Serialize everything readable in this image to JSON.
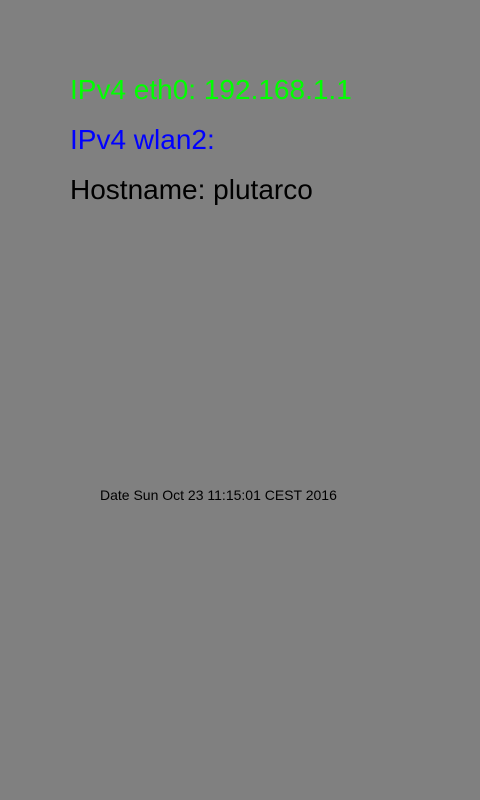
{
  "colors": {
    "background": "#808080",
    "eth0": "#00ff00",
    "wlan2": "#0000ff",
    "hostname": "#000000",
    "date": "#000000"
  },
  "network": {
    "eth0_text": "IPv4 eth0: 192.168.1.1",
    "wlan2_text": "IPv4 wlan2:"
  },
  "host": {
    "hostname_text": "Hostname: plutarco"
  },
  "status": {
    "date_text": "Date Sun Oct 23 11:15:01 CEST 2016"
  }
}
